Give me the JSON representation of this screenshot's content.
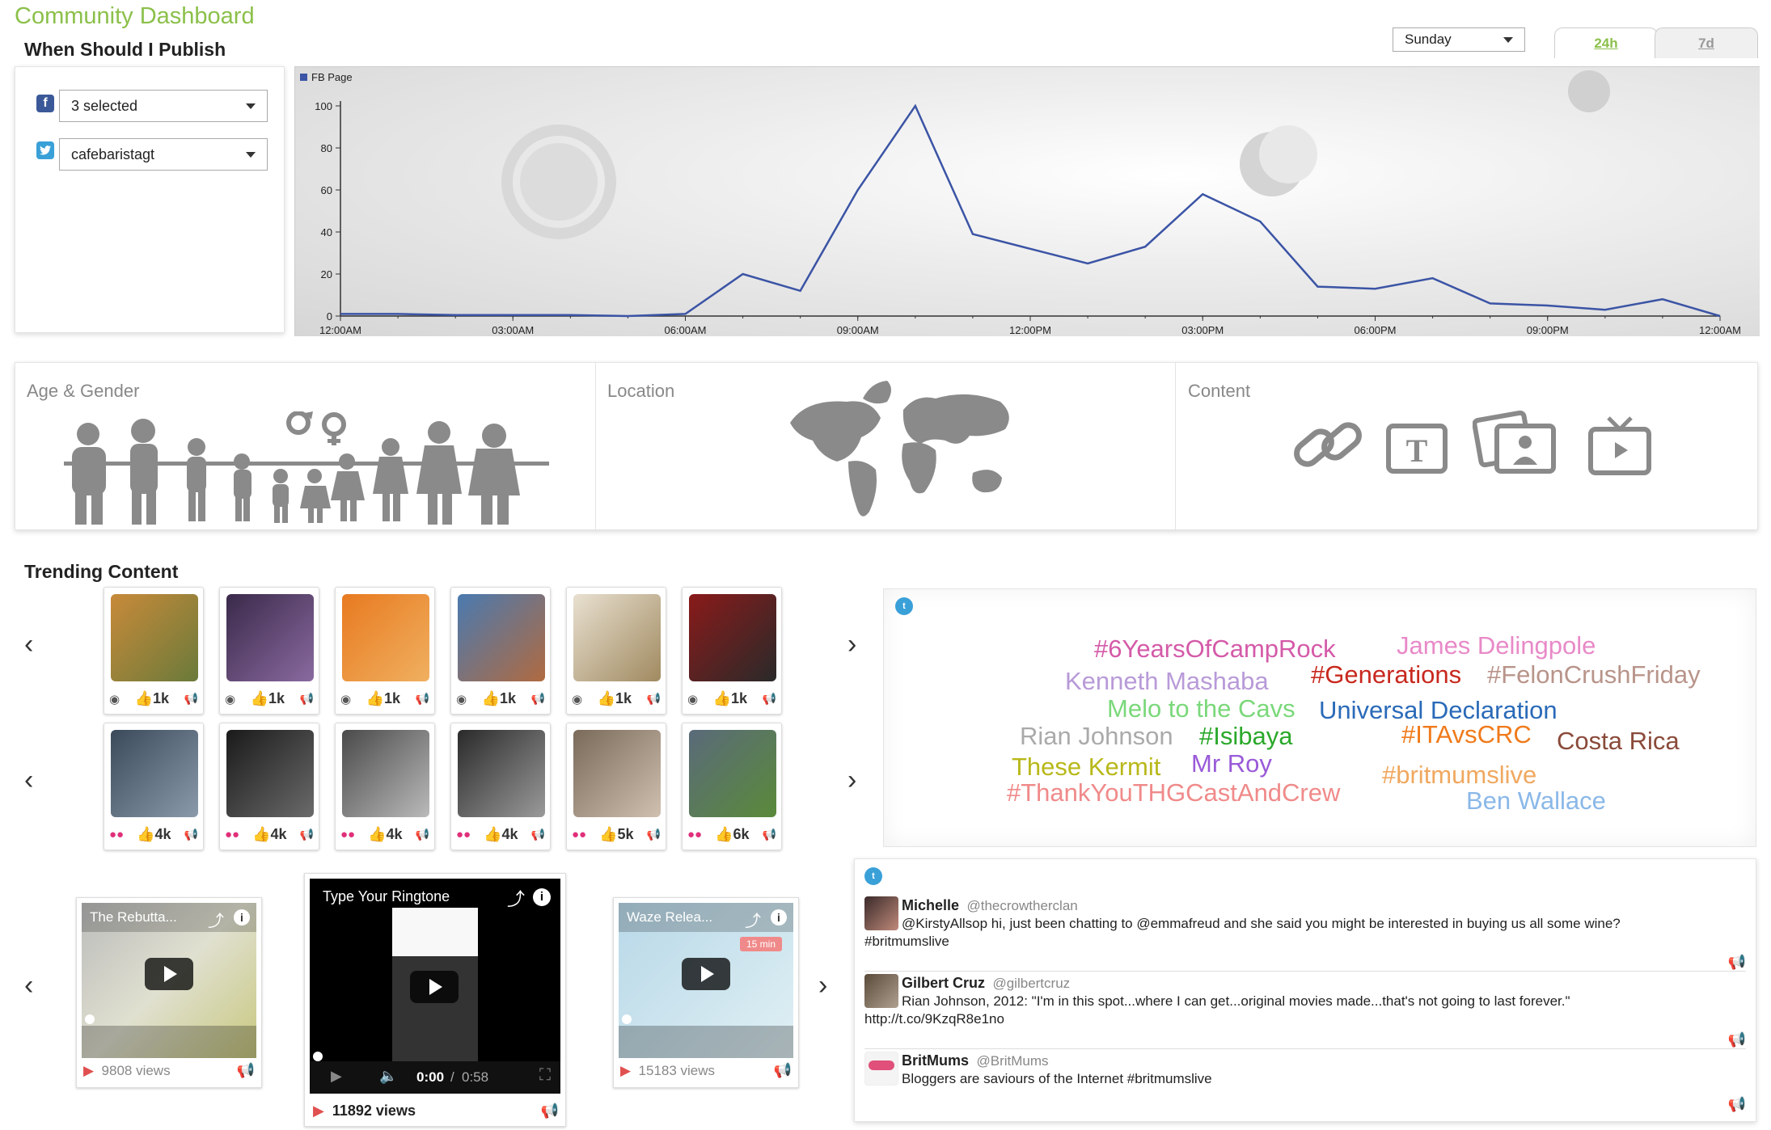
{
  "app_title": "Community Dashboard",
  "publish": {
    "title": "When Should I Publish",
    "facebook_select": "3 selected",
    "twitter_select": "cafebaristagt",
    "day_select": "Sunday",
    "tab_24h": "24h",
    "tab_7d": "7d"
  },
  "chart_data": {
    "type": "line",
    "legend": "FB Page",
    "x_ticks": [
      "12:00AM",
      "03:00AM",
      "06:00AM",
      "09:00AM",
      "12:00PM",
      "03:00PM",
      "06:00PM",
      "09:00PM",
      "12:00AM"
    ],
    "y_ticks": [
      0,
      20,
      40,
      60,
      80,
      100
    ],
    "ylim": [
      0,
      100
    ],
    "x_hours": [
      0,
      1,
      2,
      3,
      4,
      5,
      6,
      7,
      8,
      9,
      10,
      11,
      12,
      13,
      14,
      15,
      16,
      17,
      18,
      19,
      20,
      21,
      22,
      23,
      24
    ],
    "values": [
      1,
      1,
      0.5,
      0.5,
      0.5,
      0,
      1,
      20,
      12,
      60,
      100,
      39,
      32,
      25,
      33,
      58,
      45,
      14,
      13,
      18,
      6,
      5,
      3,
      8,
      0
    ],
    "grid": false
  },
  "insights": {
    "age_gender_label": "Age & Gender",
    "location_label": "Location",
    "content_label": "Content"
  },
  "trending": {
    "title": "Trending Content",
    "row1": [
      {
        "likes": "1k",
        "colors": [
          "#c88a3a",
          "#6a7a3a"
        ]
      },
      {
        "likes": "1k",
        "colors": [
          "#3a2a4a",
          "#8a6aa0"
        ]
      },
      {
        "likes": "1k",
        "colors": [
          "#e87a20",
          "#f0b060"
        ]
      },
      {
        "likes": "1k",
        "colors": [
          "#4a7ab0",
          "#b06a40"
        ]
      },
      {
        "likes": "1k",
        "colors": [
          "#e8e0d0",
          "#a08a60"
        ]
      },
      {
        "likes": "1k",
        "colors": [
          "#8a1a1a",
          "#2a2a2a"
        ]
      }
    ],
    "row2": [
      {
        "likes": "4k",
        "colors": [
          "#3a4a5a",
          "#8a9aaa"
        ]
      },
      {
        "likes": "4k",
        "colors": [
          "#1a1a1a",
          "#6a6a6a"
        ]
      },
      {
        "likes": "4k",
        "colors": [
          "#4a4a4a",
          "#bababa"
        ]
      },
      {
        "likes": "4k",
        "colors": [
          "#2a2a2a",
          "#9a9a9a"
        ]
      },
      {
        "likes": "5k",
        "colors": [
          "#7a6a5a",
          "#d0c0b0"
        ]
      },
      {
        "likes": "6k",
        "colors": [
          "#5a6a7a",
          "#5a8a3a"
        ]
      }
    ]
  },
  "word_cloud": [
    {
      "text": "#6YearsOfCampRock",
      "color": "#d45aa8"
    },
    {
      "text": "James Delingpole",
      "color": "#e88ac8"
    },
    {
      "text": "Kenneth Mashaba",
      "color": "#b89ad8"
    },
    {
      "text": "#Generations",
      "color": "#c8281e"
    },
    {
      "text": "#FelonCrushFriday",
      "color": "#b8948a"
    },
    {
      "text": "Melo to the Cavs",
      "color": "#7ad87a"
    },
    {
      "text": "Universal Declaration",
      "color": "#2a6ab8"
    },
    {
      "text": "Rian Johnson",
      "color": "#aaaaaa"
    },
    {
      "text": "#Isibaya",
      "color": "#2aa82a"
    },
    {
      "text": "#ITAvsCRC",
      "color": "#f07a1a"
    },
    {
      "text": "Costa Rica",
      "color": "#8a4a3a"
    },
    {
      "text": "These Kermit",
      "color": "#b8b81a"
    },
    {
      "text": "Mr Roy",
      "color": "#9a5ad8"
    },
    {
      "text": "#britmumslive",
      "color": "#f0a860"
    },
    {
      "text": "#ThankYouTHGCastAndCrew",
      "color": "#f08a8a"
    },
    {
      "text": "Ben Wallace",
      "color": "#8ab8e8"
    }
  ],
  "tweets": [
    {
      "name": "Michelle",
      "handle": "@thecrowtherclan",
      "text": "@KirstyAllsop hi, just been chatting to @emmafreud and she said you might be interested in buying us all some wine? #britmumslive"
    },
    {
      "name": "Gilbert Cruz",
      "handle": "@gilbertcruz",
      "text": "Rian Johnson, 2012: \"I'm in this spot...where I can get...original movies made...that's not going to last forever.\" http://t.co/9KzqR8e1no"
    },
    {
      "name": "BritMums",
      "handle": "@BritMums",
      "text": "Bloggers are saviours of the Internet #britmumslive"
    }
  ],
  "videos": [
    {
      "title": "The Rebutta...",
      "views": "9808 views"
    },
    {
      "title": "Type Your Ringtone",
      "views": "11892 views",
      "time": "0:00",
      "duration": "0:58"
    },
    {
      "title": "Waze Relea...",
      "views": "15183 views",
      "badge": "15 min"
    }
  ],
  "time_sep": "/"
}
